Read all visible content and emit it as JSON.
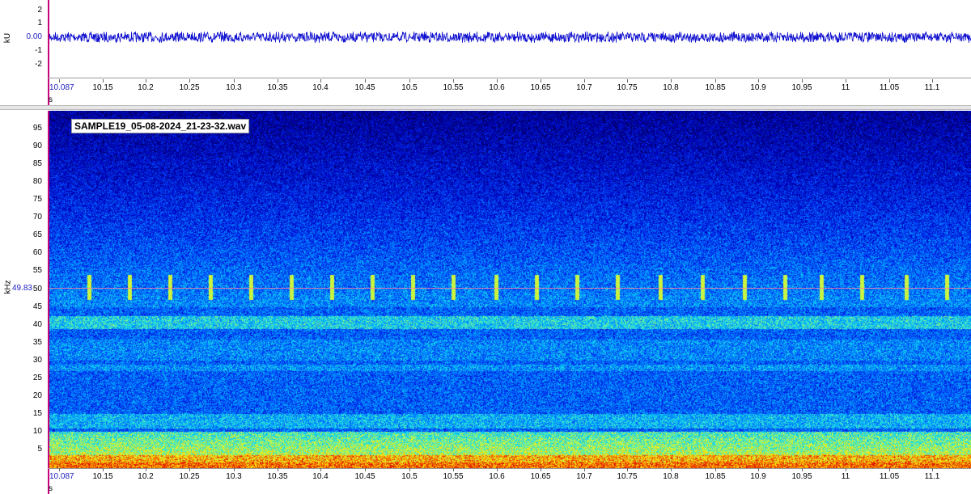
{
  "waveform": {
    "unit": "kU",
    "y_ticks": [
      "2",
      "1",
      "0.00",
      "-1",
      "-2"
    ],
    "x_unit": "s",
    "x_ticks": [
      "10.087",
      "10.15",
      "10.2",
      "10.25",
      "10.3",
      "10.35",
      "10.4",
      "10.45",
      "10.5",
      "10.55",
      "10.6",
      "10.65",
      "10.7",
      "10.75",
      "10.8",
      "10.85",
      "10.9",
      "10.95",
      "11",
      "11.05",
      "11.1"
    ]
  },
  "spectrogram": {
    "unit": "kHz",
    "file_name": "SAMPLE19_05-08-2024_21-23-32.wav",
    "cursor_value": "49.83",
    "y_ticks": [
      "95",
      "90",
      "85",
      "80",
      "75",
      "70",
      "65",
      "60",
      "55",
      "50",
      "45",
      "40",
      "35",
      "30",
      "25",
      "20",
      "15",
      "10",
      "5"
    ],
    "x_unit": "s",
    "x_ticks": [
      "10.087",
      "10.15",
      "10.2",
      "10.25",
      "10.3",
      "10.35",
      "10.4",
      "10.45",
      "10.5",
      "10.55",
      "10.6",
      "10.65",
      "10.7",
      "10.75",
      "10.8",
      "10.85",
      "10.9",
      "10.95",
      "11",
      "11.05",
      "11.1"
    ]
  },
  "colors": {
    "axis_line": "#c8007a",
    "waveform": "#1010d0",
    "highlight_text": "#2020c0",
    "cursor": "#ff7aa8"
  }
}
